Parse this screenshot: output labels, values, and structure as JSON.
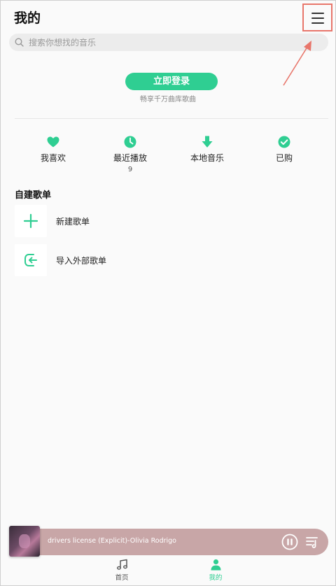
{
  "header": {
    "title": "我的"
  },
  "search": {
    "placeholder": "搜索你想找的音乐"
  },
  "login": {
    "button_label": "立即登录",
    "subtitle": "畅享千万曲库歌曲"
  },
  "quick_access": [
    {
      "label": "我喜欢",
      "icon": "heart-icon",
      "count": ""
    },
    {
      "label": "最近播放",
      "icon": "clock-icon",
      "count": "9"
    },
    {
      "label": "本地音乐",
      "icon": "download-arrow-icon",
      "count": ""
    },
    {
      "label": "已购",
      "icon": "check-circle-icon",
      "count": ""
    }
  ],
  "playlists": {
    "section_title": "自建歌单",
    "items": [
      {
        "label": "新建歌单",
        "icon": "plus-icon"
      },
      {
        "label": "导入外部歌单",
        "icon": "import-icon"
      }
    ]
  },
  "player": {
    "track": "drivers license (Explicit)-Olivia Rodrigo",
    "accent": "#c8a6a7"
  },
  "tabs": [
    {
      "label": "首页",
      "icon": "music-note-icon",
      "active": false
    },
    {
      "label": "我的",
      "icon": "person-icon",
      "active": true
    }
  ],
  "colors": {
    "brand": "#2fce92",
    "highlight": "#e8766b"
  }
}
